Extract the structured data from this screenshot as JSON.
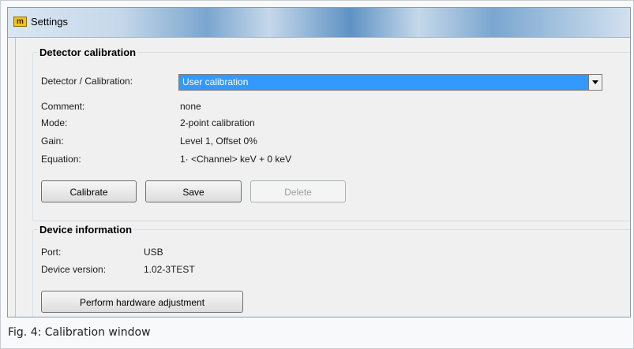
{
  "window": {
    "title": "Settings",
    "icon": "app-m-icon"
  },
  "detector_calibration": {
    "legend": "Detector calibration",
    "fields": [
      {
        "label": "Detector / Calibration:",
        "value": "User calibration"
      },
      {
        "label": "Comment:",
        "value": "none"
      },
      {
        "label": "Mode:",
        "value": "2-point calibration"
      },
      {
        "label": "Gain:",
        "value": "Level 1, Offset 0%"
      },
      {
        "label": "Equation:",
        "value": "1· <Channel> keV + 0 keV"
      }
    ],
    "buttons": {
      "calibrate": "Calibrate",
      "save": "Save",
      "delete": "Delete"
    }
  },
  "device_information": {
    "legend": "Device information",
    "fields": [
      {
        "label": "Port:",
        "value": "USB"
      },
      {
        "label": "Device version:",
        "value": "1.02-3TEST"
      }
    ],
    "button": "Perform hardware adjustment"
  },
  "caption": "Fig. 4: Calibration window"
}
